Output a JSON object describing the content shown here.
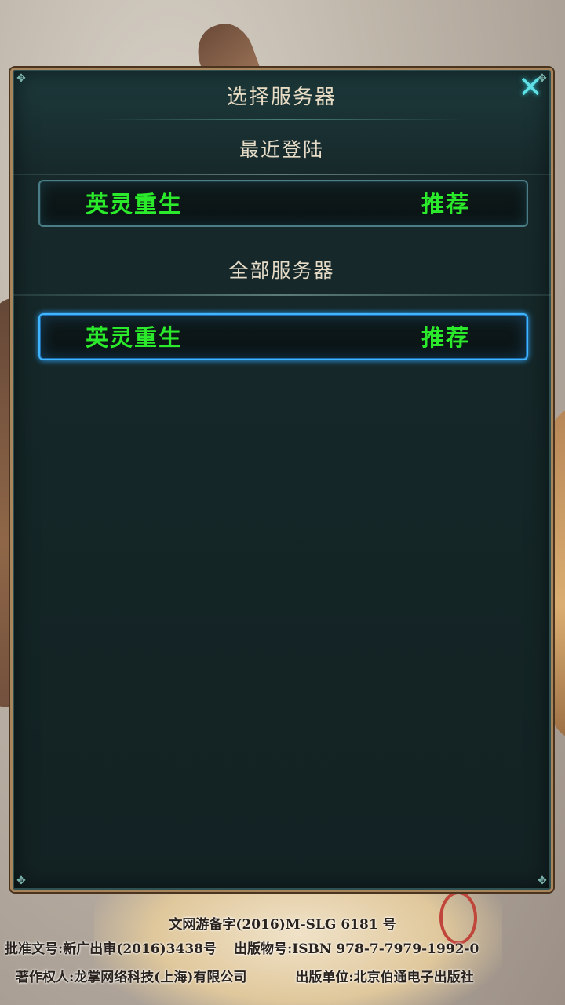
{
  "dialog": {
    "title": "选择服务器",
    "close_icon": "close-icon"
  },
  "recent": {
    "header": "最近登陆",
    "server": {
      "name": "英灵重生",
      "tag": "推荐"
    }
  },
  "all": {
    "header": "全部服务器",
    "servers": [
      {
        "name": "英灵重生",
        "tag": "推荐",
        "selected": true
      }
    ]
  },
  "footer": {
    "line1": "文网游备字(2016)M-SLG 6181 号",
    "line2_left": "批准文号:新广出审(2016)3438号",
    "line2_right": "出版物号:ISBN 978-7-7979-1992-0",
    "line3_left": "著作权人:龙掌网络科技(上海)有限公司",
    "line3_right": "出版单位:北京伯通电子出版社"
  },
  "colors": {
    "server_text": "#2bea2b",
    "selected_border": "#3fb6ff",
    "close_icon": "#5fe0e6"
  }
}
